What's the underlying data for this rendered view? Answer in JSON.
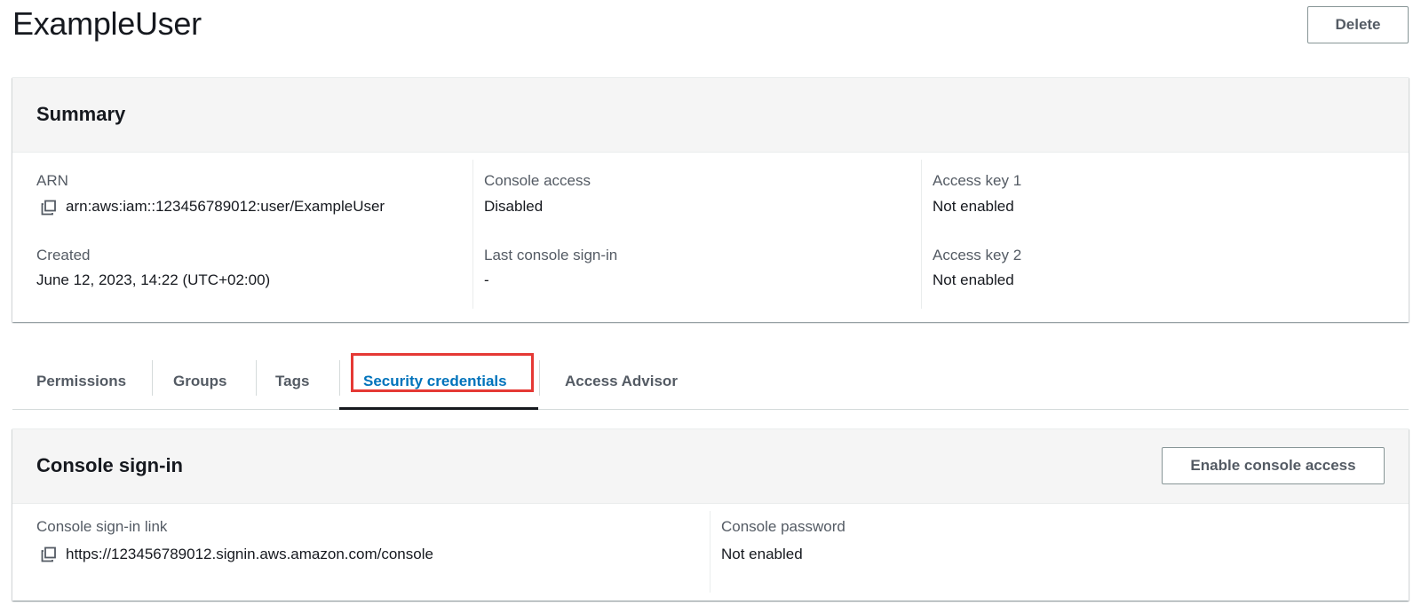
{
  "header": {
    "title": "ExampleUser",
    "delete_label": "Delete"
  },
  "summary": {
    "title": "Summary",
    "arn_label": "ARN",
    "arn_value": "arn:aws:iam::123456789012:user/ExampleUser",
    "created_label": "Created",
    "created_value": "June 12, 2023, 14:22 (UTC+02:00)",
    "console_access_label": "Console access",
    "console_access_value": "Disabled",
    "last_signin_label": "Last console sign-in",
    "last_signin_value": "-",
    "access_key1_label": "Access key 1",
    "access_key1_value": "Not enabled",
    "access_key2_label": "Access key 2",
    "access_key2_value": "Not enabled"
  },
  "tabs": [
    {
      "label": "Permissions"
    },
    {
      "label": "Groups"
    },
    {
      "label": "Tags"
    },
    {
      "label": "Security credentials",
      "active": true
    },
    {
      "label": "Access Advisor"
    }
  ],
  "console_signin": {
    "title": "Console sign-in",
    "enable_label": "Enable console access",
    "link_label": "Console sign-in link",
    "link_value": "https://123456789012.signin.aws.amazon.com/console",
    "password_label": "Console password",
    "password_value": "Not enabled"
  },
  "colors": {
    "active_tab": "#0073bb",
    "highlight": "#e53935"
  },
  "icons": {
    "copy": "copy-icon"
  }
}
